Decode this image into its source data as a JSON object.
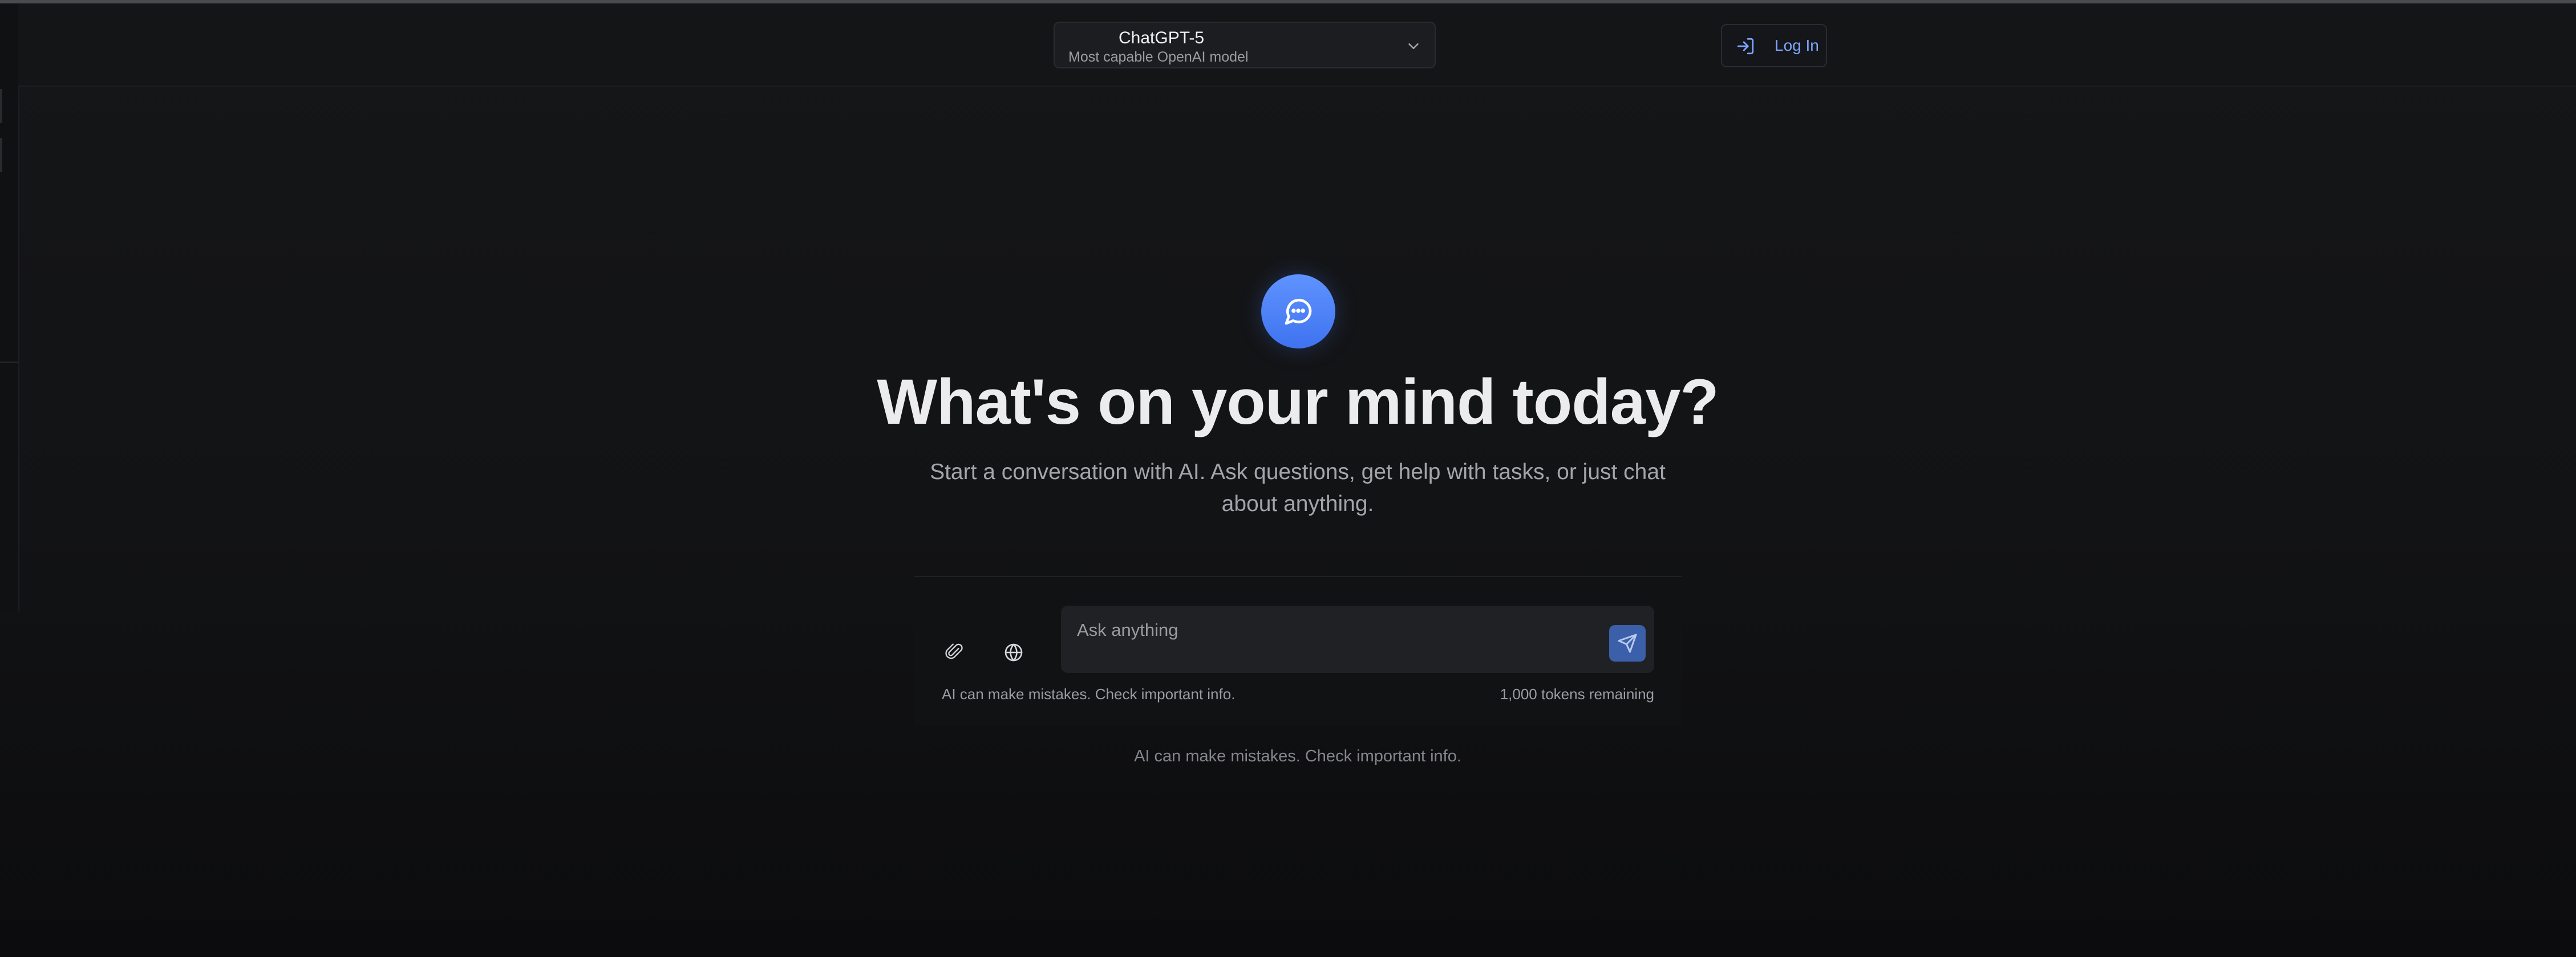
{
  "header": {
    "model_selector": {
      "name": "ChatGPT-5",
      "description": "Most capable OpenAI model",
      "chevron_icon": "chevron-down-icon"
    },
    "login": {
      "label": "Log In",
      "icon": "log-in-icon"
    }
  },
  "hero": {
    "icon": "chat-bubble-icon",
    "headline": "What's on your mind today?",
    "subtext": "Start a conversation with AI. Ask questions, get help with tasks, or just chat about anything."
  },
  "composer": {
    "attach_icon": "paperclip-icon",
    "web_icon": "globe-icon",
    "placeholder": "Ask anything",
    "value": "",
    "send_icon": "send-icon",
    "disclaimer": "AI can make mistakes. Check important info.",
    "tokens_remaining": "1,000 tokens remaining"
  },
  "footer": {
    "note": "AI can make mistakes. Check important info."
  },
  "colors": {
    "accent": "#4f84ff",
    "link": "#7ea6ff",
    "background": "#121315",
    "send_button": "#3b5fa8"
  }
}
